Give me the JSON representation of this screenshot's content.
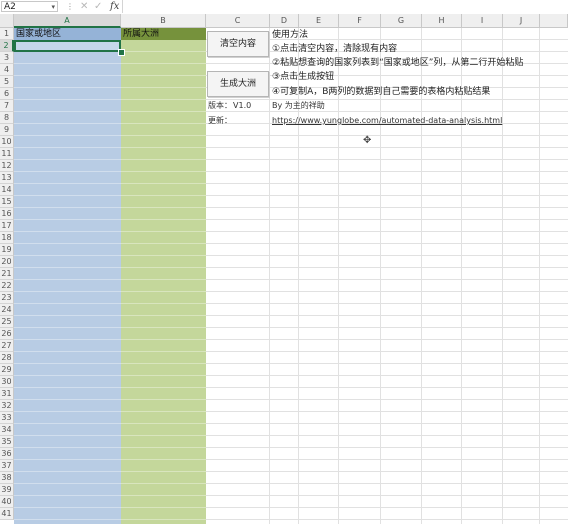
{
  "formula_bar": {
    "name_box": "A2",
    "cancel_icon": "close-icon",
    "enter_icon": "check-icon",
    "function_label": "fx",
    "formula": ""
  },
  "columns": [
    "A",
    "B",
    "C",
    "D",
    "E",
    "F",
    "G",
    "H",
    "I",
    "J"
  ],
  "rows": [
    "1",
    "2",
    "3",
    "4",
    "5",
    "6",
    "7",
    "8",
    "9",
    "10",
    "11",
    "12",
    "13",
    "14",
    "15",
    "16",
    "17",
    "18",
    "19",
    "20",
    "21",
    "22",
    "23",
    "24",
    "25",
    "26",
    "27",
    "28",
    "29",
    "30",
    "31",
    "32",
    "33",
    "34",
    "35",
    "36",
    "37",
    "38",
    "39",
    "40",
    "41"
  ],
  "selection": {
    "column": "A",
    "row": "2"
  },
  "headers": {
    "country": "国家或地区",
    "continent": "所属大洲"
  },
  "buttons": {
    "clear": "清空内容",
    "generate": "生成大洲"
  },
  "instructions": {
    "title": "使用方法",
    "step1": "①点击清空内容，清除现有内容",
    "step2": "②粘贴想查询的国家列表到“国家或地区”列，从第二行开始粘贴",
    "step3": "③点击生成按钮",
    "step4": "④可复制A，B两列的数据到自己需要的表格内粘贴结果"
  },
  "info": {
    "version_label": "版本：",
    "version": "V1.0",
    "author": "By 为主的祥助",
    "update_label": "更新：",
    "update_url": "https://www.yunglobe.com/automated-data-analysis.html"
  },
  "colors": {
    "header_a": "#95b3d7",
    "header_b": "#76923c",
    "fill_a": "#b8cce4",
    "fill_b": "#c4d79b",
    "selection": "#217346",
    "link": "#0563c1"
  }
}
